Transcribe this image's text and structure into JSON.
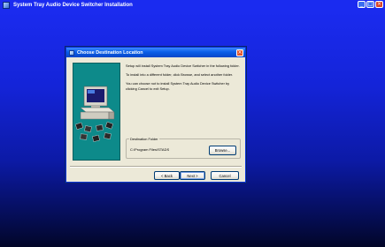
{
  "installer": {
    "title": "System Tray Audio Device Switcher Installation",
    "window_buttons": {
      "minimize": "_",
      "maximize": "□",
      "close": "×"
    }
  },
  "dialog": {
    "title": "Choose Destination Location",
    "close_glyph": "×",
    "paragraphs": [
      "Setup will install System Tray Audio Device Switcher in the following folder.",
      "To install into a different folder, click Browse, and select another folder.",
      "You can choose not to install System Tray Audio Device Switcher by clicking Cancel to exit Setup."
    ],
    "destination_folder": {
      "label": "Destination Folder",
      "path": "C:\\Program Files\\STADS",
      "browse_label": "Browse..."
    },
    "buttons": {
      "back": "< Back",
      "next": "Next >",
      "cancel": "Cancel"
    }
  },
  "colors": {
    "desktop_top": "#1c2cf2",
    "desktop_bottom": "#020628",
    "dialog_bg": "#ece9d8",
    "title_bar": "#0a5ee8",
    "art_panel": "#0d8a8a"
  },
  "icons": [
    "installer-app-icon",
    "setup-computer-illustration",
    "dialog-close-icon"
  ]
}
